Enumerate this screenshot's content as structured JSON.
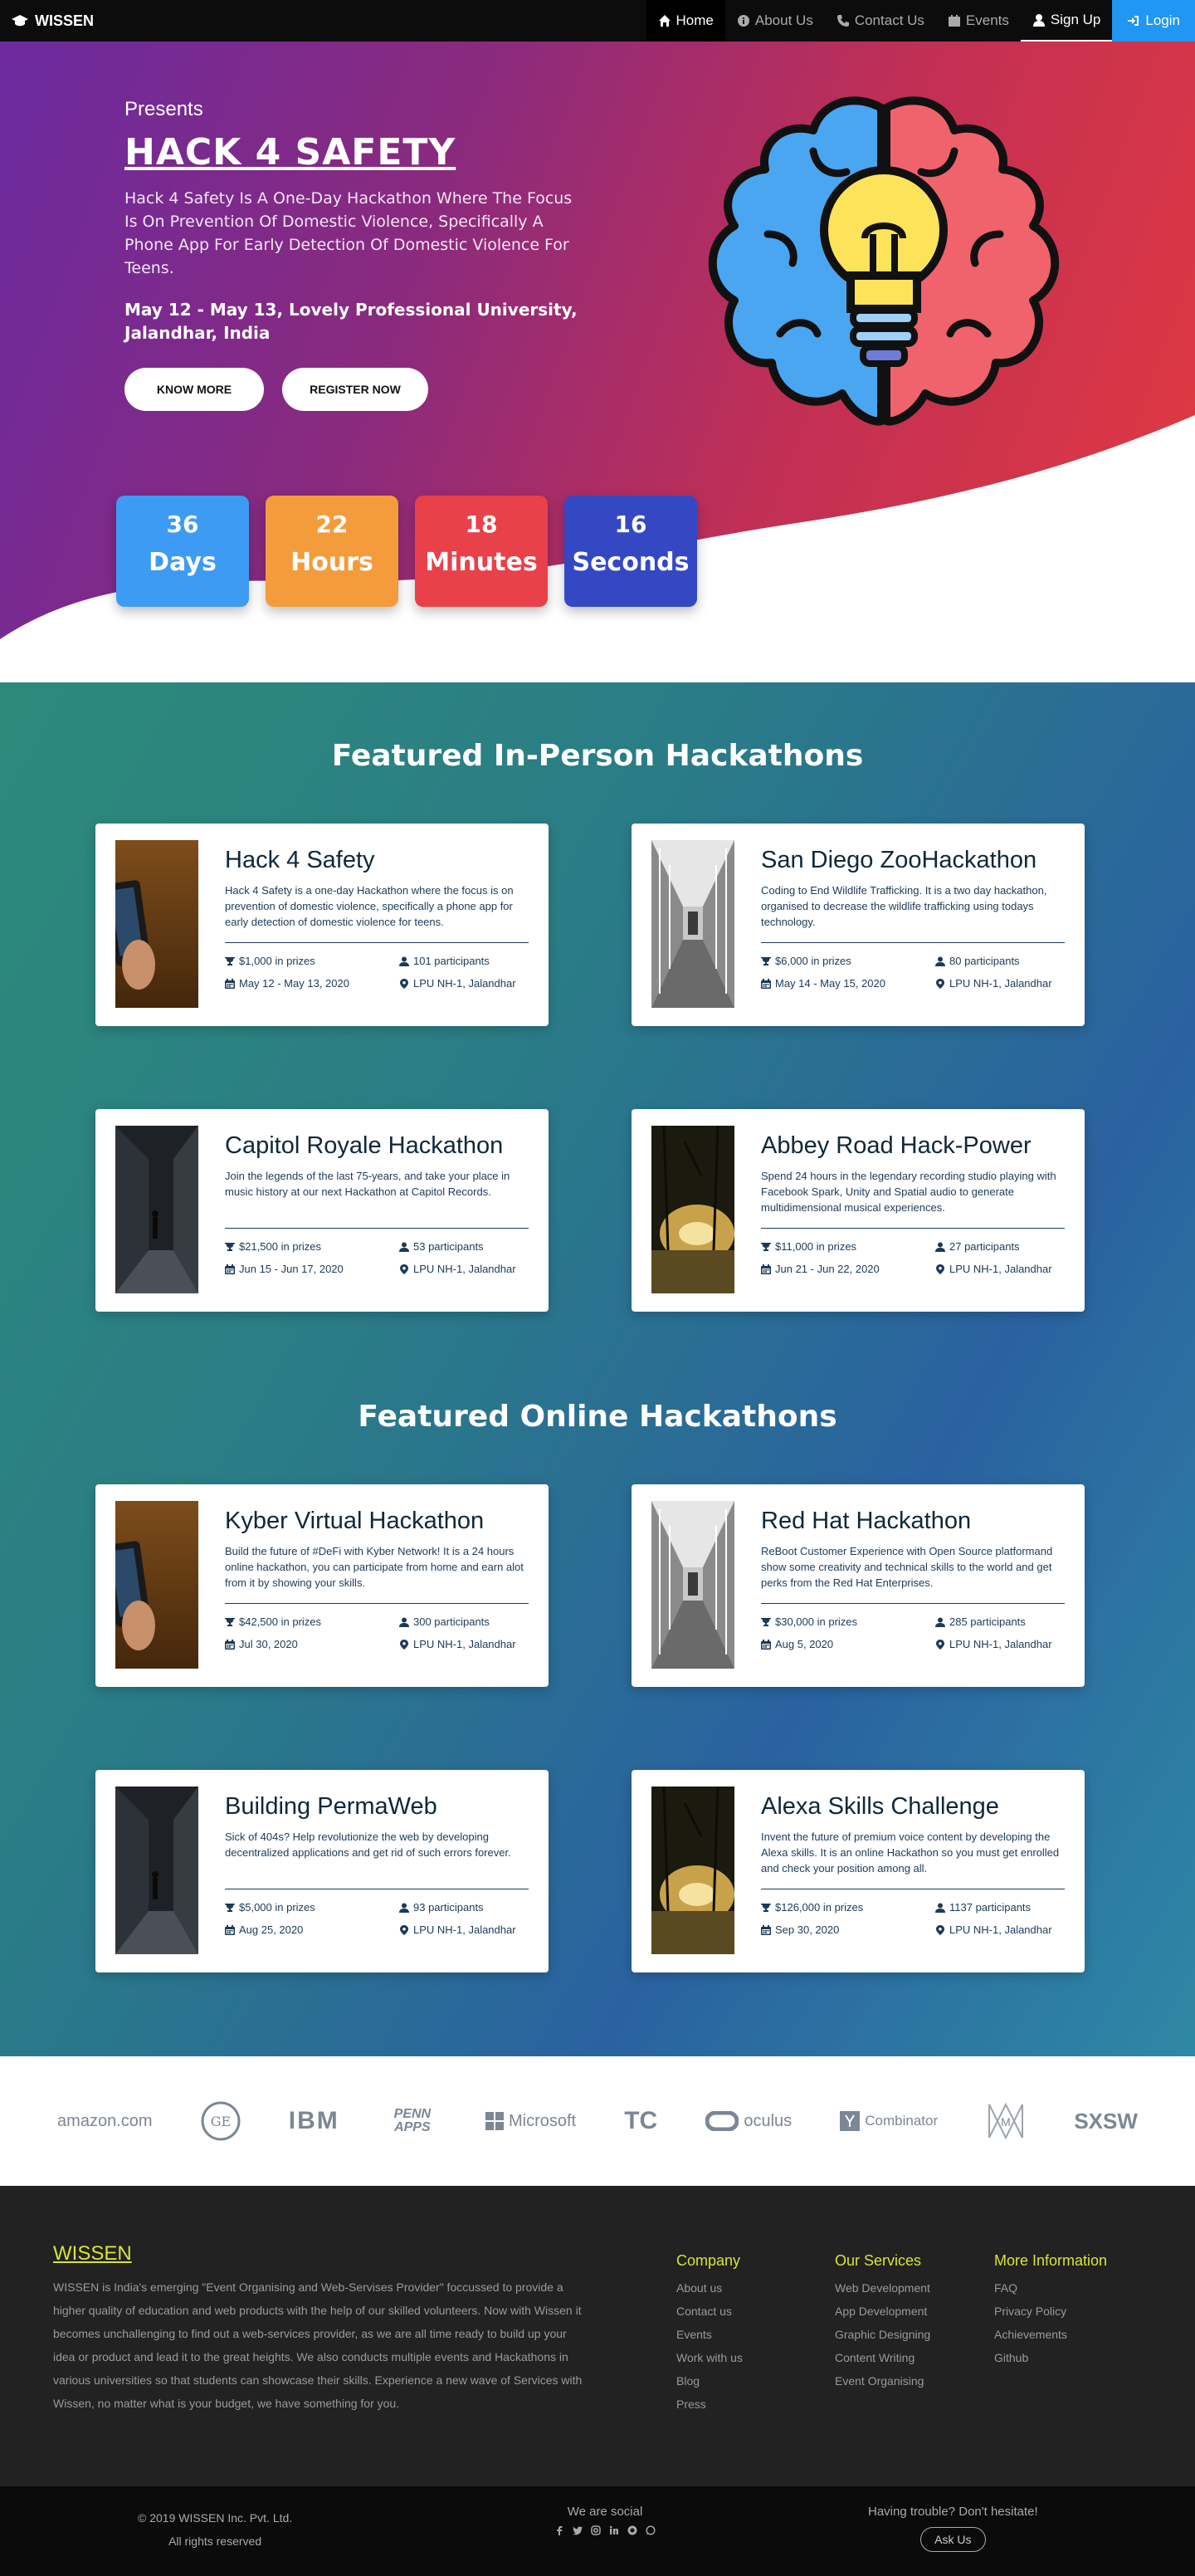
{
  "nav": {
    "brand": "WISSEN",
    "links": [
      {
        "label": "Home"
      },
      {
        "label": "About Us"
      },
      {
        "label": "Contact Us"
      },
      {
        "label": "Events"
      },
      {
        "label": "Sign Up"
      },
      {
        "label": "Login"
      }
    ]
  },
  "hero": {
    "presents": "Presents",
    "title": "HACK 4 SAFETY",
    "description": "Hack 4 Safety Is A One-Day Hackathon Where The Focus Is On Prevention Of Domestic Violence, Specifically A Phone App For Early Detection Of Domestic Violence For Teens.",
    "date_place": "May 12 - May 13, Lovely Professional University, Jalandhar, India",
    "btn_know": "KNOW MORE",
    "btn_register": "REGISTER NOW",
    "counters": [
      {
        "value": "36",
        "label": "Days",
        "color": "#3d9bf4"
      },
      {
        "value": "22",
        "label": "Hours",
        "color": "#f49b3b"
      },
      {
        "value": "18",
        "label": "Minutes",
        "color": "#e8414a"
      },
      {
        "value": "16",
        "label": "Seconds",
        "color": "#3548c4"
      }
    ]
  },
  "inperson": {
    "title": "Featured In-Person Hackathons",
    "cards": [
      {
        "title": "Hack 4 Safety",
        "desc": "Hack 4 Safety is a one-day Hackathon where the focus is on prevention of domestic violence, specifically a phone app for early detection of domestic violence for teens.",
        "prizes": "$1,000 in prizes",
        "participants": "101 participants",
        "dates": "May 12 - May 13, 2020",
        "location": "LPU NH-1, Jalandhar",
        "image": "phone"
      },
      {
        "title": "San Diego ZooHackathon",
        "desc": "Coding to End Wildlife Trafficking. It is a two day hackathon, organised to decrease the wildlife trafficking using todays technology.",
        "prizes": "$6,000 in prizes",
        "participants": "80 participants",
        "dates": "May 14 - May 15, 2020",
        "location": "LPU NH-1, Jalandhar",
        "image": "corridor"
      },
      {
        "title": "Capitol Royale Hackathon",
        "desc": "Join the legends of the last 75-years, and take your place in music history at our next Hackathon at Capitol Records.",
        "prizes": "$21,500 in prizes",
        "participants": "53 participants",
        "dates": "Jun 15 - Jun 17, 2020",
        "location": "LPU NH-1, Jalandhar",
        "image": "hall"
      },
      {
        "title": "Abbey Road Hack-Power",
        "desc": "Spend 24 hours in the legendary recording studio playing with Facebook Spark, Unity and Spatial audio to generate multidimensional musical experiences.",
        "prizes": "$11,000 in prizes",
        "participants": "27 participants",
        "dates": "Jun 21 - Jun 22, 2020",
        "location": "LPU NH-1, Jalandhar",
        "image": "sunset"
      }
    ]
  },
  "online": {
    "title": "Featured Online Hackathons",
    "cards": [
      {
        "title": "Kyber Virtual Hackathon",
        "desc": "Build the future of #DeFi with Kyber Network! It is a 24 hours online hackathon, you can participate from home and earn alot from it by showing your skills.",
        "prizes": "$42,500 in prizes",
        "participants": "300 participants",
        "dates": "Jul 30, 2020",
        "location": "LPU NH-1, Jalandhar",
        "image": "phone"
      },
      {
        "title": "Red Hat Hackathon",
        "desc": "ReBoot Customer Experience with Open Source platformand show some creativity and technical skills to the world and get perks from the Red Hat Enterprises.",
        "prizes": "$30,000 in prizes",
        "participants": "285 participants",
        "dates": "Aug 5, 2020",
        "location": "LPU NH-1, Jalandhar",
        "image": "corridor"
      },
      {
        "title": "Building PermaWeb",
        "desc": "Sick of 404s? Help revolutionize the web by developing decentralized applications and get rid of such errors forever.",
        "prizes": "$5,000 in prizes",
        "participants": "93 participants",
        "dates": "Aug 25, 2020",
        "location": "LPU NH-1, Jalandhar",
        "image": "hall"
      },
      {
        "title": "Alexa Skills Challenge",
        "desc": "Invent the future of premium voice content by developing the Alexa skills. It is an online Hackathon so you must get enrolled and check your position among all.",
        "prizes": "$126,000 in prizes",
        "participants": "1137 participants",
        "dates": "Sep 30, 2020",
        "location": "LPU NH-1, Jalandhar",
        "image": "sunset"
      }
    ]
  },
  "sponsors": [
    "amazon.com",
    "GE",
    "IBM",
    "PENN APPS",
    "Microsoft",
    "TC",
    "oculus",
    "Combinator",
    "M",
    "SXSW"
  ],
  "footer": {
    "brand": "WISSEN",
    "about": "WISSEN is India's emerging \"Event Organising and Web-Servises Provider\" foccussed to provide a higher quality of education and web products with the help of our skilled volunteers. Now with Wissen it becomes unchallenging to find out a web-services provider, as we are all time ready to build up your idea or product and lead it to the great heights. We also conducts multiple events and Hackathons in various universities so that students can showcase their skills. Experience a new wave of Services with Wissen, no matter what is your budget, we have something for you.",
    "company": {
      "title": "Company",
      "items": [
        "About us",
        "Contact us",
        "Events",
        "Work with us",
        "Blog",
        "Press"
      ]
    },
    "services": {
      "title": "Our Services",
      "items": [
        "Web Development",
        "App Development",
        "Graphic Designing",
        "Content Writing",
        "Event Organising"
      ]
    },
    "more": {
      "title": "More Information",
      "items": [
        "FAQ",
        "Privacy Policy",
        "Achievements",
        "Github"
      ]
    }
  },
  "bottom": {
    "copyright": "© 2019 WISSEN Inc. Pvt. Ltd.",
    "rights": "All rights reserved",
    "social": "We are social",
    "help": "Having trouble? Don't hesitate!",
    "ask": "Ask Us"
  }
}
